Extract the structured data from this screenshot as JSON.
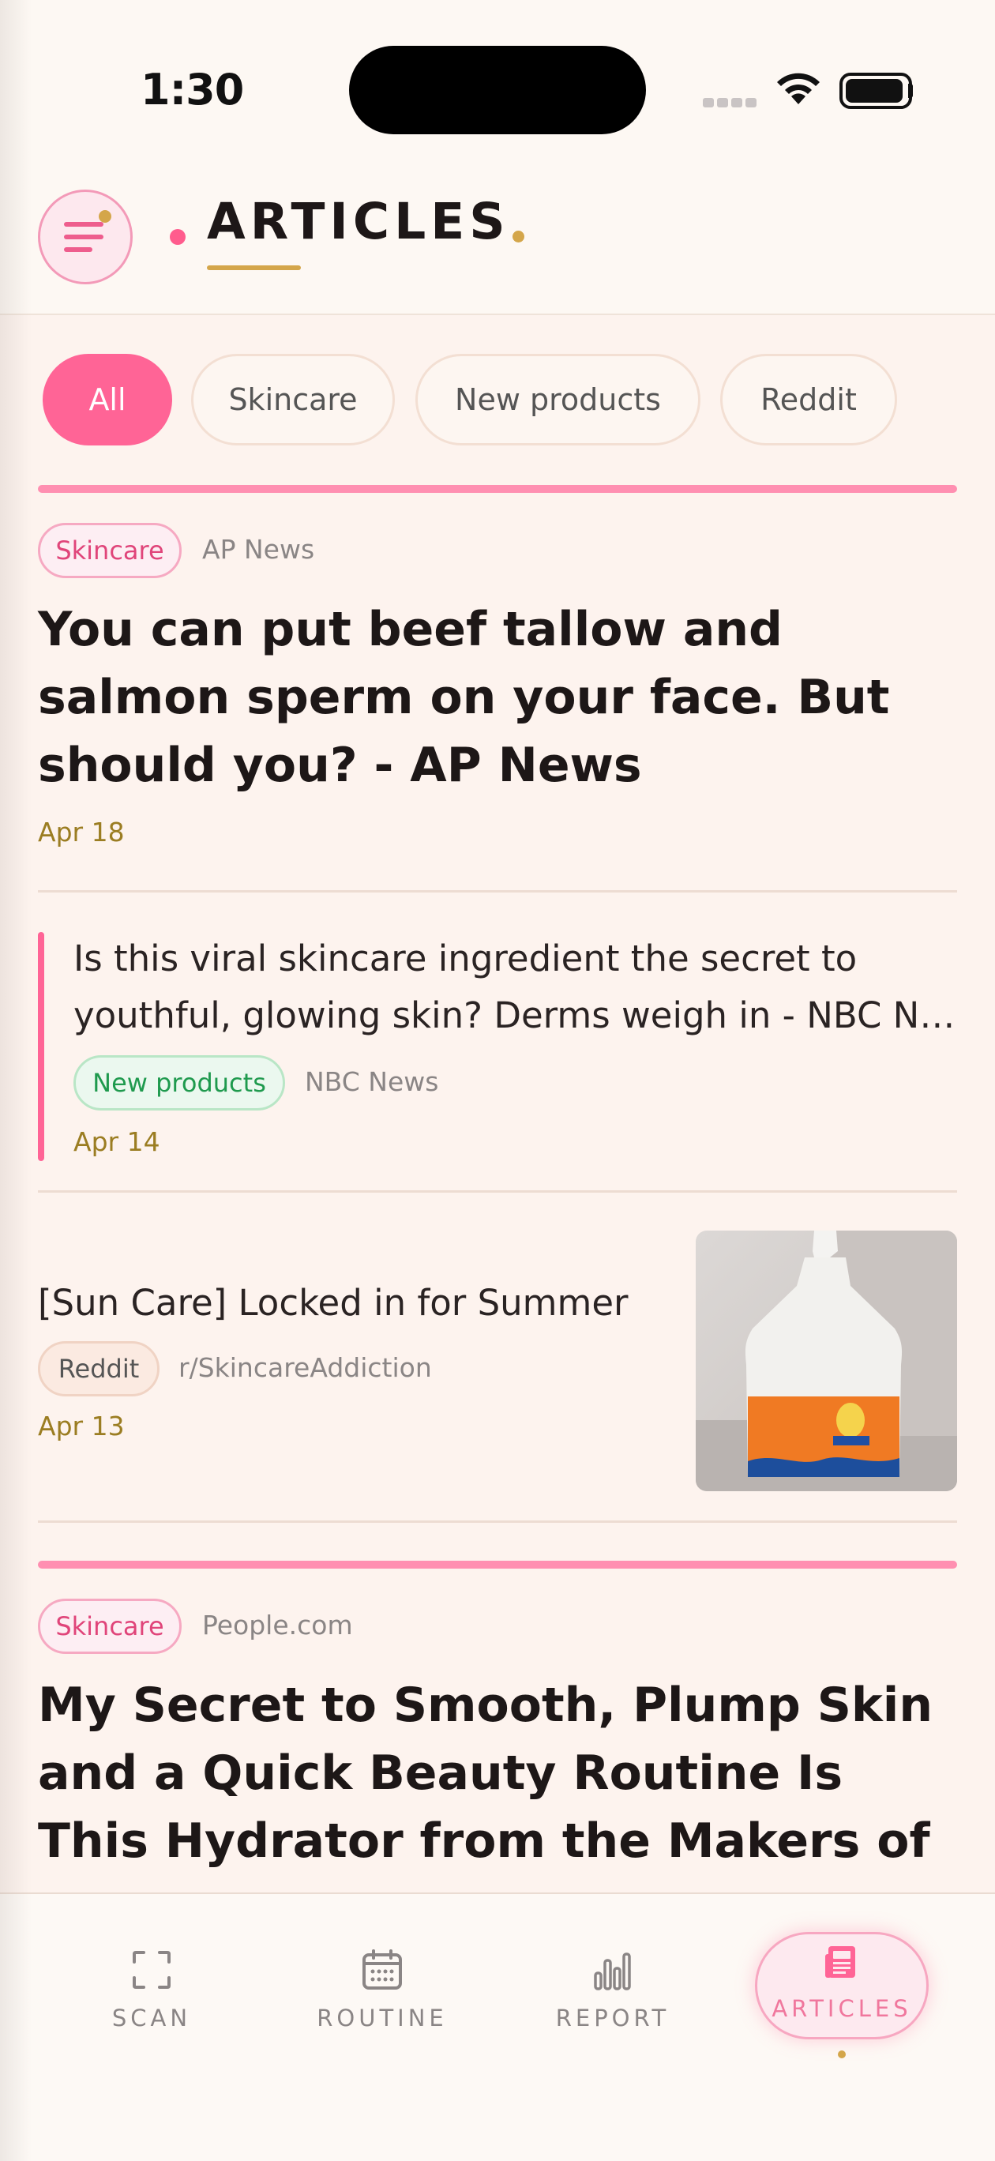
{
  "status_bar": {
    "time": "1:30"
  },
  "header": {
    "title": "ARTICLES",
    "menu_icon": "menu-icon"
  },
  "filters": [
    "All",
    "Skincare",
    "New products",
    "Reddit"
  ],
  "articles": [
    {
      "tag": "Skincare",
      "source": "AP News",
      "title": "You can put beef tallow and salmon sperm on your face. But should you? - AP News",
      "date": "Apr 18"
    },
    {
      "title_line1": "Is this viral skincare ingredient the secret to",
      "title_line2": "youthful, glowing skin? Derms weigh in - NBC News",
      "tag": "New products",
      "source": "NBC News",
      "date": "Apr 14"
    },
    {
      "title": "[Sun Care] Locked in for Summer",
      "tag": "Reddit",
      "source": "r/SkincareAddiction",
      "date": "Apr 13",
      "thumbnail": "sunscreen-bottle-photo"
    },
    {
      "tag": "Skincare",
      "source": "People.com",
      "title": "My Secret to Smooth, Plump Skin and a Quick Beauty Routine Is This Hydrator from the Makers of Botox -..."
    }
  ],
  "nav": {
    "scan": "SCAN",
    "routine": "ROUTINE",
    "report": "REPORT",
    "articles": "ARTICLES"
  },
  "colors": {
    "accent_pink": "#ff6496",
    "gold": "#d4a64a",
    "background": "#fdf3ee"
  }
}
